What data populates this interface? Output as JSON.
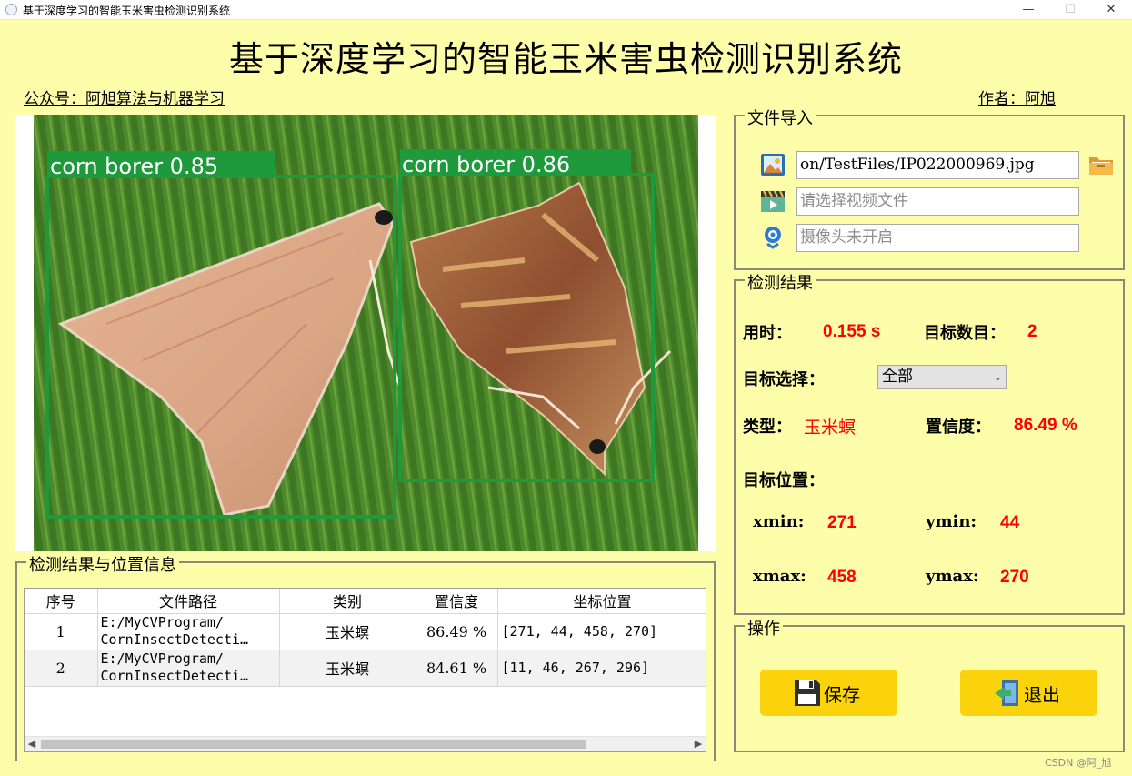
{
  "window": {
    "title": "基于深度学习的智能玉米害虫检测识别系统",
    "min_glyph": "—",
    "max_glyph": "☐",
    "close_glyph": "✕"
  },
  "header": {
    "title": "基于深度学习的智能玉米害虫检测识别系统",
    "left_link": "公众号：阿旭算法与机器学习",
    "right_link": "作者：阿旭"
  },
  "image_panel": {
    "detections": [
      {
        "label": "corn borer 0.85"
      },
      {
        "label": "corn borer 0.86"
      }
    ],
    "box_color": "#1e9a3c"
  },
  "results_table": {
    "group_title": "检测结果与位置信息",
    "columns": [
      "序号",
      "文件路径",
      "类别",
      "置信度",
      "坐标位置"
    ],
    "rows": [
      {
        "index": "1",
        "path_line1": "E:/MyCVProgram/",
        "path_line2": "CornInsectDetecti…",
        "class": "玉米螟",
        "confidence": "86.49 %",
        "coords": "[271, 44, 458, 270]"
      },
      {
        "index": "2",
        "path_line1": "E:/MyCVProgram/",
        "path_line2": "CornInsectDetecti…",
        "class": "玉米螟",
        "confidence": "84.61 %",
        "coords": "[11, 46, 267, 296]"
      }
    ]
  },
  "file_import": {
    "group_title": "文件导入",
    "image_path": "on/TestFiles/IP022000969.jpg",
    "video_placeholder": "请选择视频文件",
    "camera_placeholder": "摄像头未开启",
    "icons": [
      "image-icon",
      "video-icon",
      "camera-icon",
      "folder-icon"
    ]
  },
  "detection_result": {
    "group_title": "检测结果",
    "time_label": "用时：",
    "time_value": "0.155 s",
    "count_label": "目标数目：",
    "count_value": "2",
    "select_label": "目标选择：",
    "select_value": "全部",
    "type_label": "类型：",
    "type_value": "玉米螟",
    "conf_label": "置信度：",
    "conf_value": "86.49 %",
    "position_label": "目标位置：",
    "xmin_label": "xmin:",
    "xmin_value": "271",
    "ymin_label": "ymin:",
    "ymin_value": "44",
    "xmax_label": "xmax:",
    "xmax_value": "458",
    "ymax_label": "ymax:",
    "ymax_value": "270",
    "value_color": "#ff0000"
  },
  "operations": {
    "group_title": "操作",
    "save_label": "保存",
    "exit_label": "退出",
    "button_color": "#fbd30d"
  },
  "watermark": "CSDN @阿_旭"
}
